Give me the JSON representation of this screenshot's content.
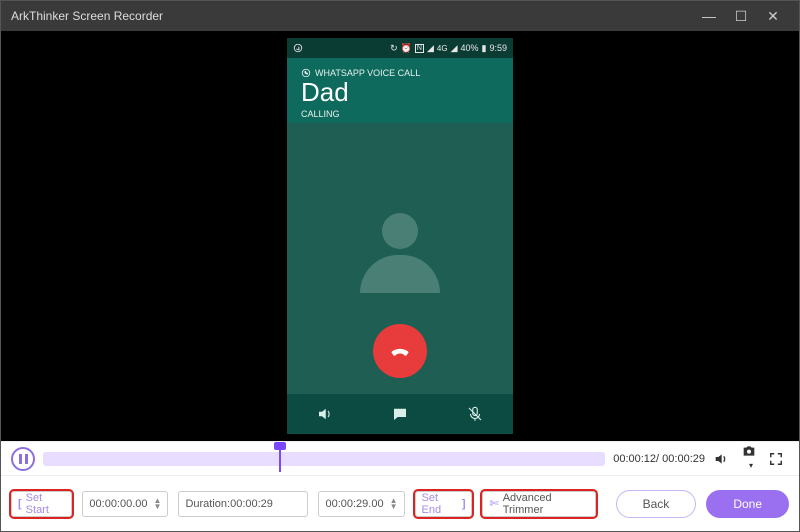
{
  "window": {
    "title": "ArkThinker Screen Recorder"
  },
  "phone": {
    "status_time": "9:59",
    "battery": "40%",
    "voice_call_label": "WHATSAPP VOICE CALL",
    "contact_name": "Dad",
    "call_status": "CALLING"
  },
  "timeline": {
    "current": "00:00:12",
    "total": "00:00:29"
  },
  "controls": {
    "set_start_label": "Set Start",
    "start_time": "00:00:00.00",
    "duration_label": "Duration:00:00:29",
    "end_time": "00:00:29.00",
    "set_end_label": "Set End",
    "adv_trimmer_label": "Advanced Trimmer",
    "back_label": "Back",
    "done_label": "Done"
  }
}
